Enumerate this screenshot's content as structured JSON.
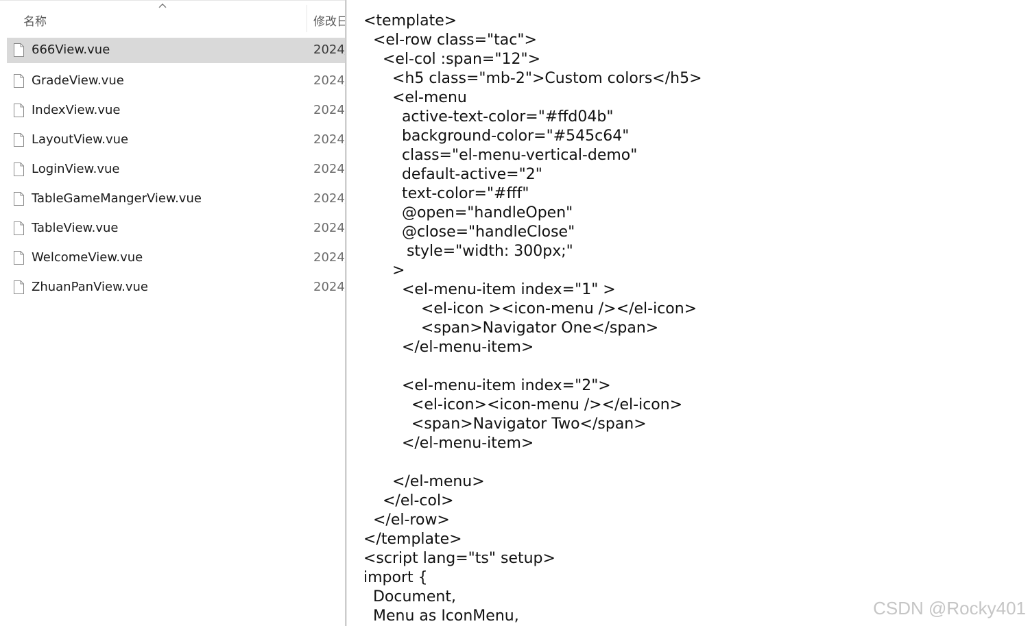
{
  "explorer": {
    "header": {
      "name_label": "名称",
      "date_label": "修改日",
      "sort": "ascending"
    },
    "files": [
      {
        "name": "666View.vue",
        "date": "2024/",
        "selected": true
      },
      {
        "name": "GradeView.vue",
        "date": "2024/"
      },
      {
        "name": "IndexView.vue",
        "date": "2024/"
      },
      {
        "name": "LayoutView.vue",
        "date": "2024/"
      },
      {
        "name": "LoginView.vue",
        "date": "2024/"
      },
      {
        "name": "TableGameMangerView.vue",
        "date": "2024/"
      },
      {
        "name": "TableView.vue",
        "date": "2024/"
      },
      {
        "name": "WelcomeView.vue",
        "date": "2024/"
      },
      {
        "name": "ZhuanPanView.vue",
        "date": "2024/"
      }
    ]
  },
  "code": {
    "lines": [
      "<template>",
      "  <el-row class=\"tac\">",
      "    <el-col :span=\"12\">",
      "      <h5 class=\"mb-2\">Custom colors</h5>",
      "      <el-menu",
      "        active-text-color=\"#ffd04b\"",
      "        background-color=\"#545c64\"",
      "        class=\"el-menu-vertical-demo\"",
      "        default-active=\"2\"",
      "        text-color=\"#fff\"",
      "        @open=\"handleOpen\"",
      "        @close=\"handleClose\"",
      "         style=\"width: 300px;\"",
      "      >",
      "        <el-menu-item index=\"1\" >",
      "            <el-icon ><icon-menu /></el-icon>",
      "            <span>Navigator One</span>",
      "        </el-menu-item>",
      "",
      "        <el-menu-item index=\"2\">",
      "          <el-icon><icon-menu /></el-icon>",
      "          <span>Navigator Two</span>",
      "        </el-menu-item>",
      "",
      "      </el-menu>",
      "    </el-col>",
      "  </el-row>",
      "</template>",
      "<script lang=\"ts\" setup>",
      "import {",
      "  Document,",
      "  Menu as IconMenu,"
    ]
  },
  "watermark": "CSDN @Rocky401",
  "colors": {
    "selected_row": "#d9d9d9",
    "header_text": "#5a5a5a",
    "date_text": "#6d6d6d",
    "code_text": "#111111"
  },
  "icons": {
    "file": "file-icon",
    "sort": "sort-up-icon"
  }
}
